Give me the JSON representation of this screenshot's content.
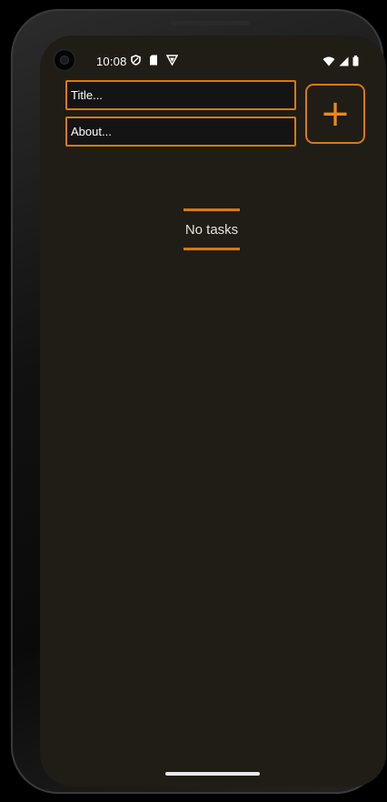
{
  "status_bar": {
    "time": "10:08",
    "left_icons": [
      "shield-icon",
      "sim-card-icon",
      "vpn-badge-icon"
    ],
    "right_icons": [
      "wifi-icon",
      "cell-signal-icon",
      "battery-icon"
    ]
  },
  "form": {
    "title_placeholder": "Title...",
    "about_placeholder": "About...",
    "add_button_label": "+"
  },
  "task_list": {
    "empty_message": "No tasks"
  },
  "colors": {
    "accent": "#d97a0d",
    "background": "#1f1d16",
    "input_background": "#141414",
    "text": "#ffffff"
  }
}
